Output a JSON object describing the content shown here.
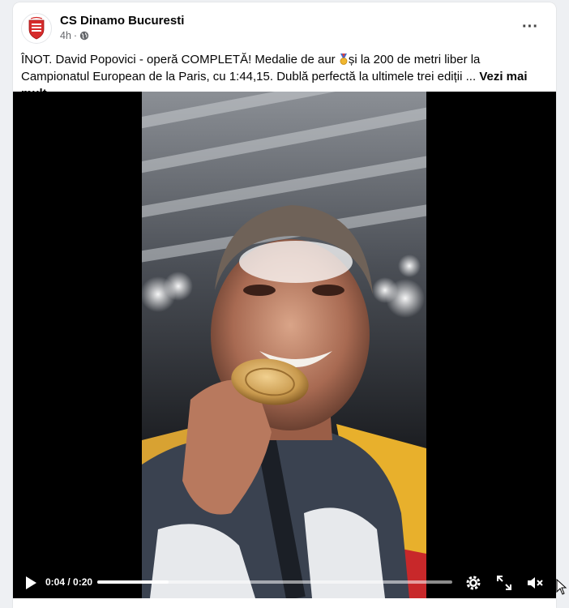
{
  "post": {
    "author": "CS Dinamo Bucuresti",
    "time": "4h",
    "separator": "·",
    "more_label": "···",
    "text_before_emoji": "ÎNOT. David Popovici - operă COMPLETĂ! Medalie de aur ",
    "text_after_emoji": "și la 200 de metri liber la Campionatul European de la Paris, cu 1:44,15. Dublă perfectă la ultimele trei ediții ... ",
    "see_more": "Vezi mai mult"
  },
  "video": {
    "time_display": "0:04 / 0:20",
    "progress": 0.2,
    "icons": [
      "play-icon",
      "settings-gear-icon",
      "fullscreen-icon",
      "muted-speaker-icon"
    ]
  },
  "colors": {
    "accent_red": "#d62b2b",
    "text_primary": "#050505",
    "text_secondary": "#65676b"
  }
}
